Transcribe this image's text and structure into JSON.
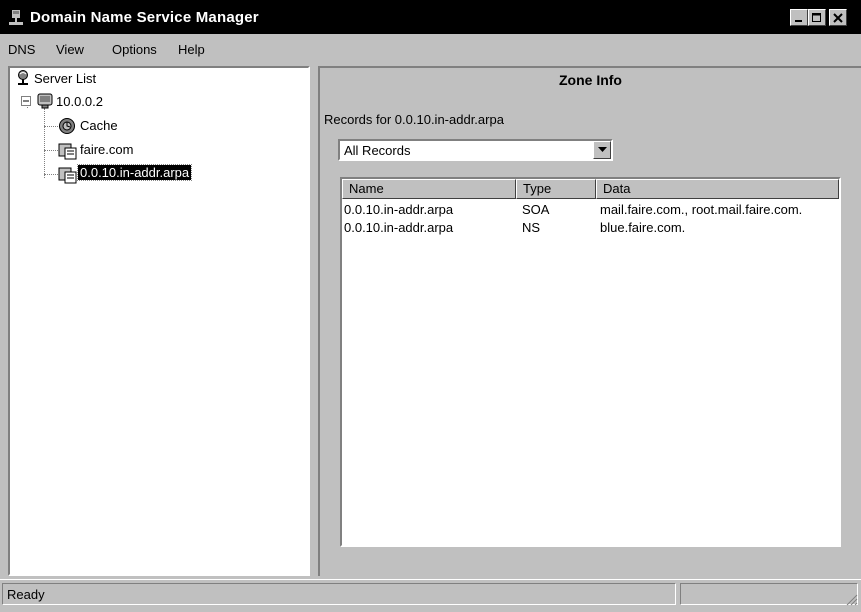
{
  "window": {
    "title": "Domain Name Service Manager"
  },
  "menu": [
    {
      "label": "DNS"
    },
    {
      "label": "View"
    },
    {
      "label": "Options"
    },
    {
      "label": "Help"
    }
  ],
  "tree": {
    "root": "Server List",
    "server": "10.0.0.2",
    "children": [
      "Cache",
      "faire.com",
      "0.0.10.in-addr.arpa"
    ],
    "selected": "0.0.10.in-addr.arpa"
  },
  "zone": {
    "title": "Zone Info",
    "records_label": "Records for 0.0.10.in-addr.arpa",
    "filter": "All Records",
    "columns": [
      "Name",
      "Type",
      "Data"
    ],
    "rows": [
      [
        "0.0.10.in-addr.arpa",
        "SOA",
        "mail.faire.com., root.mail.faire.com."
      ],
      [
        "0.0.10.in-addr.arpa",
        "NS",
        "blue.faire.com."
      ]
    ]
  },
  "status": {
    "text": "Ready"
  }
}
